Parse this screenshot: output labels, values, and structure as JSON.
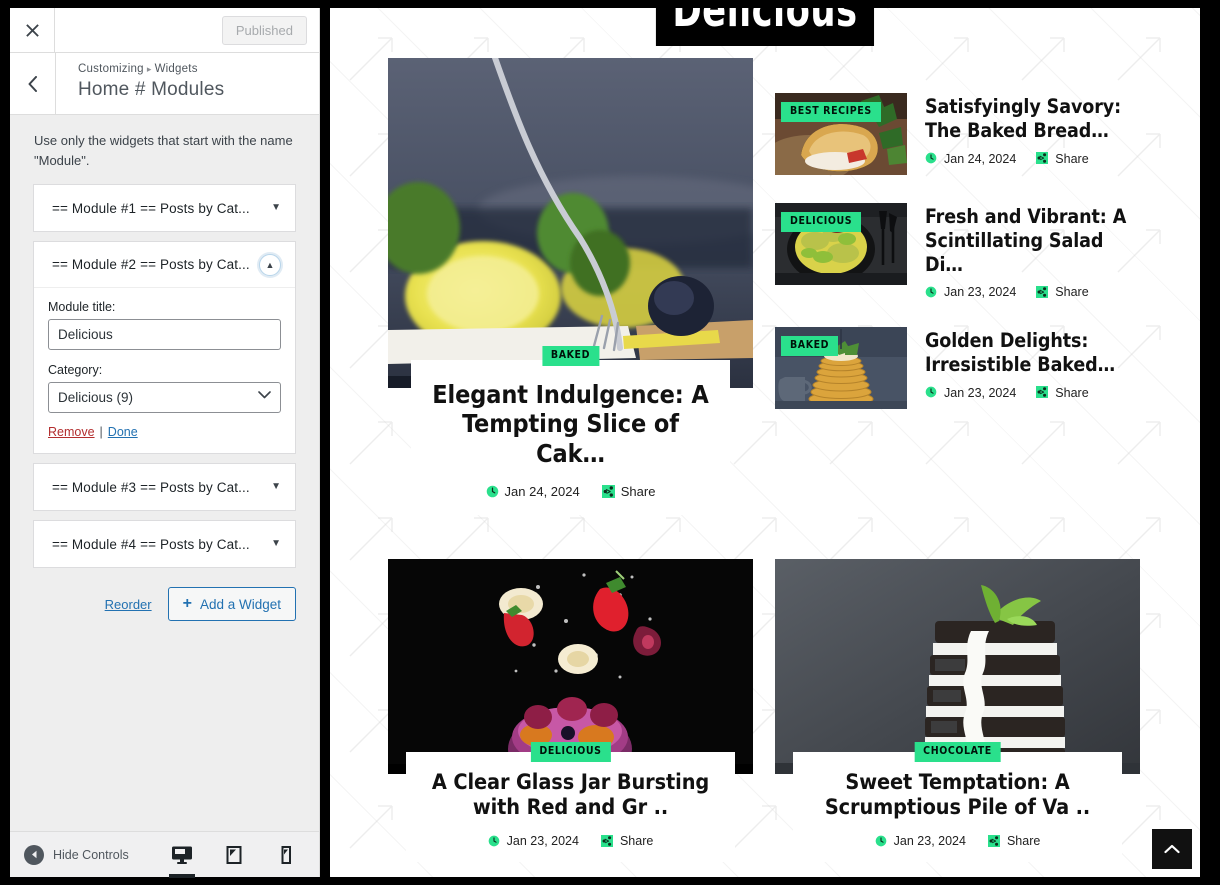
{
  "customizer": {
    "close_icon": "close-x-icon",
    "published_label": "Published",
    "back_icon": "chevron-left-icon",
    "breadcrumb_root": "Customizing",
    "breadcrumb_sep": "▸",
    "breadcrumb_section": "Widgets",
    "panel_title": "Home # Modules",
    "description": "Use only the widgets that start with the name \"Module\".",
    "widgets": [
      {
        "title": "== Module #1 == Posts by Cat...",
        "expanded": false,
        "caret": "▼"
      },
      {
        "title": "== Module #2 == Posts by Cat...",
        "expanded": true,
        "caret": "▲"
      },
      {
        "title": "== Module #3 == Posts by Cat...",
        "expanded": false,
        "caret": "▼"
      },
      {
        "title": "== Module #4 == Posts by Cat...",
        "expanded": false,
        "caret": "▼"
      }
    ],
    "expanded_widget": {
      "module_title_label": "Module title:",
      "module_title_value": "Delicious",
      "module_title_placeholder": "",
      "category_label": "Category:",
      "category_value": "Delicious  (9)",
      "remove_label": "Remove",
      "separator": "|",
      "done_label": "Done"
    },
    "reorder_label": "Reorder",
    "add_widget_label": "Add a Widget",
    "add_widget_icon": "plus-icon",
    "footer": {
      "hide_controls_label": "Hide Controls",
      "hide_controls_icon": "collapse-left-icon",
      "devices": [
        {
          "name": "desktop",
          "icon": "desktop-icon",
          "active": true
        },
        {
          "name": "tablet",
          "icon": "tablet-icon",
          "active": false
        },
        {
          "name": "mobile",
          "icon": "mobile-icon",
          "active": false
        }
      ]
    }
  },
  "preview": {
    "site_title": "Delicious",
    "scroll_top_icon": "chevron-up-icon",
    "featured": {
      "badge": "BAKED",
      "title": "Elegant Indulgence: A Tempting Slice of Cak…",
      "date": "Jan 24, 2024",
      "share": "Share",
      "date_icon": "clock-icon",
      "share_icon": "share-icon"
    },
    "side_posts": [
      {
        "badge": "BEST RECIPES",
        "title": "Satisfyingly Savory: The Baked Bread…",
        "date": "Jan 24, 2024",
        "share": "Share"
      },
      {
        "badge": "DELICIOUS",
        "title": "Fresh and Vibrant: A Scintillating Salad Di…",
        "date": "Jan 23, 2024",
        "share": "Share"
      },
      {
        "badge": "BAKED",
        "title": "Golden Delights: Irresistible Baked…",
        "date": "Jan 23, 2024",
        "share": "Share"
      }
    ],
    "grid_posts": [
      {
        "badge": "DELICIOUS",
        "title": "A Clear Glass Jar Bursting with Red and Gr ..",
        "date": "Jan 23, 2024",
        "share": "Share"
      },
      {
        "badge": "CHOCOLATE",
        "title": "Sweet Temptation: A Scrumptious Pile of Va ..",
        "date": "Jan 23, 2024",
        "share": "Share"
      }
    ]
  },
  "colors": {
    "accent_green": "#2ae08c",
    "link_blue": "#2271b1",
    "remove_red": "#b32d2e",
    "sidebar_bg": "#eeeeee",
    "title_black": "#000000"
  }
}
